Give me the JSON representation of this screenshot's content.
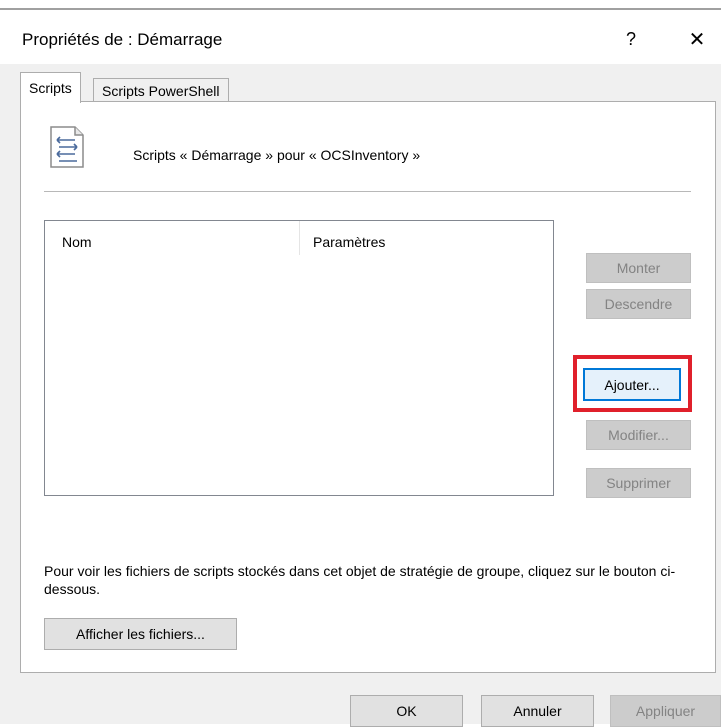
{
  "window": {
    "title": "Propriétés de : Démarrage",
    "help_label": "?",
    "close_label": "✕"
  },
  "tabs": [
    {
      "label": "Scripts",
      "active": true
    },
    {
      "label": "Scripts PowerShell",
      "active": false
    }
  ],
  "content": {
    "icon": "script-document-icon",
    "heading": "Scripts « Démarrage » pour « OCSInventory »"
  },
  "list": {
    "columns": [
      "Nom",
      "Paramètres"
    ],
    "rows": []
  },
  "side_buttons": {
    "monter": "Monter",
    "descendre": "Descendre",
    "ajouter": "Ajouter...",
    "modifier": "Modifier...",
    "supprimer": "Supprimer"
  },
  "footer": {
    "note": "Pour voir les fichiers de scripts stockés dans cet objet de stratégie de groupe, cliquez sur le bouton ci-dessous.",
    "show_files": "Afficher les fichiers..."
  },
  "dialog_buttons": {
    "ok": "OK",
    "cancel": "Annuler",
    "apply": "Appliquer"
  },
  "colors": {
    "highlight": "#e0202b",
    "focus": "#0078d7"
  }
}
